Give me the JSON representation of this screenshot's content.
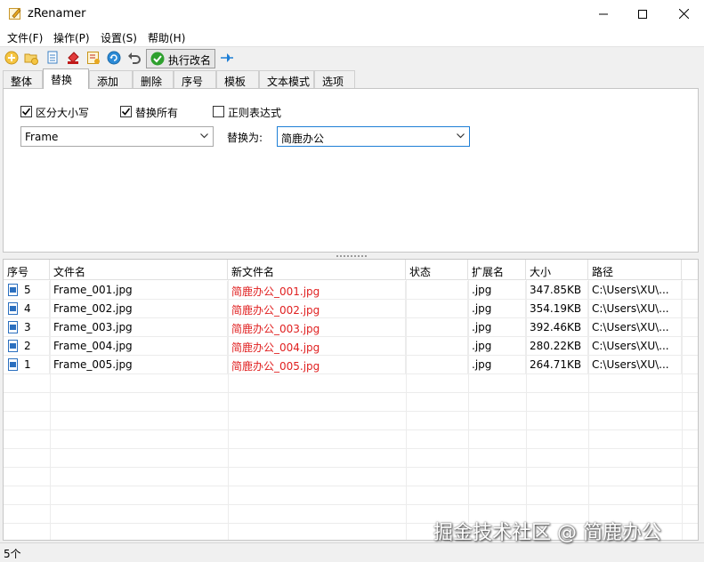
{
  "window": {
    "title": "zRenamer"
  },
  "menu": [
    "文件(F)",
    "操作(P)",
    "设置(S)",
    "帮助(H)"
  ],
  "toolbar": {
    "icons": [
      "add-icon",
      "add-folder-icon",
      "copy-icon",
      "clear-icon",
      "edit-list-icon",
      "refresh-icon",
      "undo-icon",
      "pin-icon"
    ],
    "execute_label": "执行改名",
    "colors": {
      "execute_check": "#2ea02e",
      "accent": "#1e7fd6"
    }
  },
  "tabs": [
    "整体",
    "替换",
    "添加",
    "删除",
    "序号",
    "模板",
    "文本模式",
    "选项"
  ],
  "active_tab": "替换",
  "replace_panel": {
    "case_sensitive": {
      "label": "区分大小写",
      "checked": true
    },
    "replace_all": {
      "label": "替换所有",
      "checked": true
    },
    "regex": {
      "label": "正则表达式",
      "checked": false
    },
    "find_value": "Frame",
    "replace_label": "替换为:",
    "replace_value": "简鹿办公"
  },
  "table": {
    "columns": [
      "序号",
      "文件名",
      "新文件名",
      "状态",
      "扩展名",
      "大小",
      "路径"
    ],
    "rows": [
      {
        "index": "5",
        "name": "Frame_001.jpg",
        "new_name": "简鹿办公_001.jpg",
        "status": "",
        "ext": ".jpg",
        "size": "347.85KB",
        "path": "C:\\Users\\XU\\..."
      },
      {
        "index": "4",
        "name": "Frame_002.jpg",
        "new_name": "简鹿办公_002.jpg",
        "status": "",
        "ext": ".jpg",
        "size": "354.19KB",
        "path": "C:\\Users\\XU\\..."
      },
      {
        "index": "3",
        "name": "Frame_003.jpg",
        "new_name": "简鹿办公_003.jpg",
        "status": "",
        "ext": ".jpg",
        "size": "392.46KB",
        "path": "C:\\Users\\XU\\..."
      },
      {
        "index": "2",
        "name": "Frame_004.jpg",
        "new_name": "简鹿办公_004.jpg",
        "status": "",
        "ext": ".jpg",
        "size": "280.22KB",
        "path": "C:\\Users\\XU\\..."
      },
      {
        "index": "1",
        "name": "Frame_005.jpg",
        "new_name": "简鹿办公_005.jpg",
        "status": "",
        "ext": ".jpg",
        "size": "264.71KB",
        "path": "C:\\Users\\XU\\..."
      }
    ],
    "new_name_color": "#e02020"
  },
  "status": {
    "count": "5个"
  },
  "watermark": "掘金技术社区 @ 简鹿办公"
}
